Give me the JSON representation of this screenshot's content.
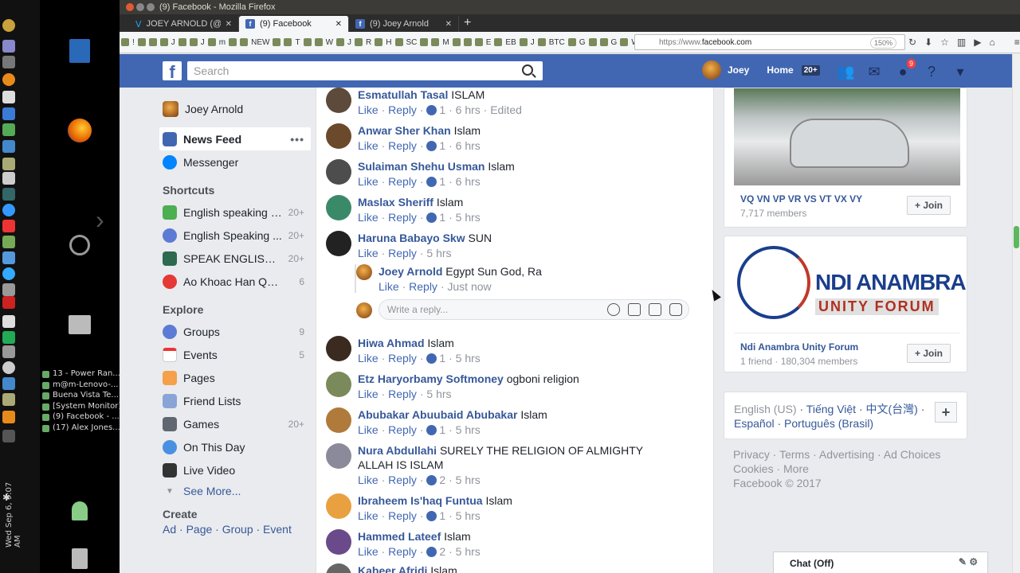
{
  "desktop": {
    "window_list": [
      "13 - Power Ran...",
      "m@m-Lenovo-...",
      "Buena Vista Te...",
      "[System Monitor]",
      "(9) Facebook - ...",
      "(17) Alex Jones..."
    ],
    "clock": "Wed Sep 6, 9:07 AM"
  },
  "browser": {
    "window_title": "(9) Facebook - Mozilla Firefox",
    "tabs": [
      {
        "label": "JOEY ARNOLD (@joey"
      },
      {
        "label": "(9) Facebook"
      },
      {
        "label": "(9) Joey Arnold"
      }
    ],
    "bookmarks": [
      "!",
      "",
      "",
      "J",
      "",
      "J",
      "m",
      "",
      "NEW",
      "",
      "T",
      "",
      "W",
      "J",
      "R",
      "H",
      "SC",
      "",
      "M",
      "",
      "",
      "E",
      "EB",
      "J",
      "BTC",
      "G",
      "",
      "G",
      "WOW"
    ],
    "url_prefix": "https://www.",
    "url_domain": "facebook.com",
    "zoom": "150%"
  },
  "facebook": {
    "search_placeholder": "Search",
    "user_name": "Joey",
    "home_label": "Home",
    "home_badge": "20+",
    "notif_count": "9",
    "left": {
      "profile_name": "Joey Arnold",
      "news_feed": "News Feed",
      "messenger": "Messenger",
      "shortcuts_header": "Shortcuts",
      "shortcuts": [
        {
          "label": "English speaking g...",
          "count": "20+"
        },
        {
          "label": "English Speaking ...",
          "count": "20+"
        },
        {
          "label": "SPEAK ENGLISH ...",
          "count": "20+"
        },
        {
          "label": "Ao Khoac Han Quo...",
          "count": "6"
        }
      ],
      "explore_header": "Explore",
      "explore": [
        {
          "label": "Groups",
          "count": "9"
        },
        {
          "label": "Events",
          "count": "5"
        },
        {
          "label": "Pages",
          "count": ""
        },
        {
          "label": "Friend Lists",
          "count": ""
        },
        {
          "label": "Games",
          "count": "20+"
        },
        {
          "label": "On This Day",
          "count": ""
        },
        {
          "label": "Live Video",
          "count": ""
        }
      ],
      "see_more": "See More...",
      "create_header": "Create",
      "create_links": "Ad · Page · Group · Event"
    },
    "comments": [
      {
        "name": "Esmatullah Tasal",
        "text": "ISLAM",
        "likes": "1",
        "time": "6 hrs · Edited"
      },
      {
        "name": "Anwar Sher Khan",
        "text": "Islam",
        "likes": "1",
        "time": "6 hrs"
      },
      {
        "name": "Sulaiman Shehu Usman",
        "text": "Islam",
        "likes": "1",
        "time": "6 hrs"
      },
      {
        "name": "Maslax Sheriff",
        "text": "Islam",
        "likes": "1",
        "time": "5 hrs"
      },
      {
        "name": "Haruna Babayo Skw",
        "text": "SUN",
        "likes": "",
        "time": "5 hrs"
      },
      {
        "name": "Hiwa Ahmad",
        "text": "Islam",
        "likes": "1",
        "time": "5 hrs"
      },
      {
        "name": "Etz Haryorbamy Softmoney",
        "text": "ogboni religion",
        "likes": "",
        "time": "5 hrs"
      },
      {
        "name": "Abubakar Abuubaid Abubakar",
        "text": "Islam",
        "likes": "1",
        "time": "5 hrs"
      },
      {
        "name": "Nura Abdullahi",
        "text": "SURELY THE RELIGION OF ALMIGHTY ALLAH IS ISLAM",
        "likes": "2",
        "time": "5 hrs"
      },
      {
        "name": "Ibraheem Is'haq Funtua",
        "text": "Islam",
        "likes": "1",
        "time": "5 hrs"
      },
      {
        "name": "Hammed Lateef",
        "text": "Islam",
        "likes": "2",
        "time": "5 hrs"
      },
      {
        "name": "Kabeer Afridi",
        "text": "Islam",
        "likes": "",
        "time": ""
      }
    ],
    "reply": {
      "name": "Joey Arnold",
      "text": "Egypt Sun God, Ra",
      "time": "Just now"
    },
    "like_label": "Like",
    "reply_label": "Reply",
    "reply_placeholder": "Write a reply...",
    "groups": [
      {
        "name": "VQ VN VP VR VS VT VX VY",
        "meta": "7,717 members",
        "join": "Join"
      },
      {
        "name": "Ndi Anambra Unity Forum",
        "meta": "1 friend · 180,304 members",
        "join": "Join",
        "logo_line1": "NDI ANAMBRA",
        "logo_line2": "UNITY FORUM"
      }
    ],
    "languages": {
      "l1": "English (US)",
      "l2": "Tiếng Việt",
      "l3": "中文(台灣)",
      "l4": "Español",
      "l5": "Português (Brasil)"
    },
    "footer1": "Privacy · Terms · Advertising · Ad Choices",
    "footer2": "Cookies · More",
    "footer3": "Facebook © 2017",
    "chat": "Chat (Off)"
  }
}
